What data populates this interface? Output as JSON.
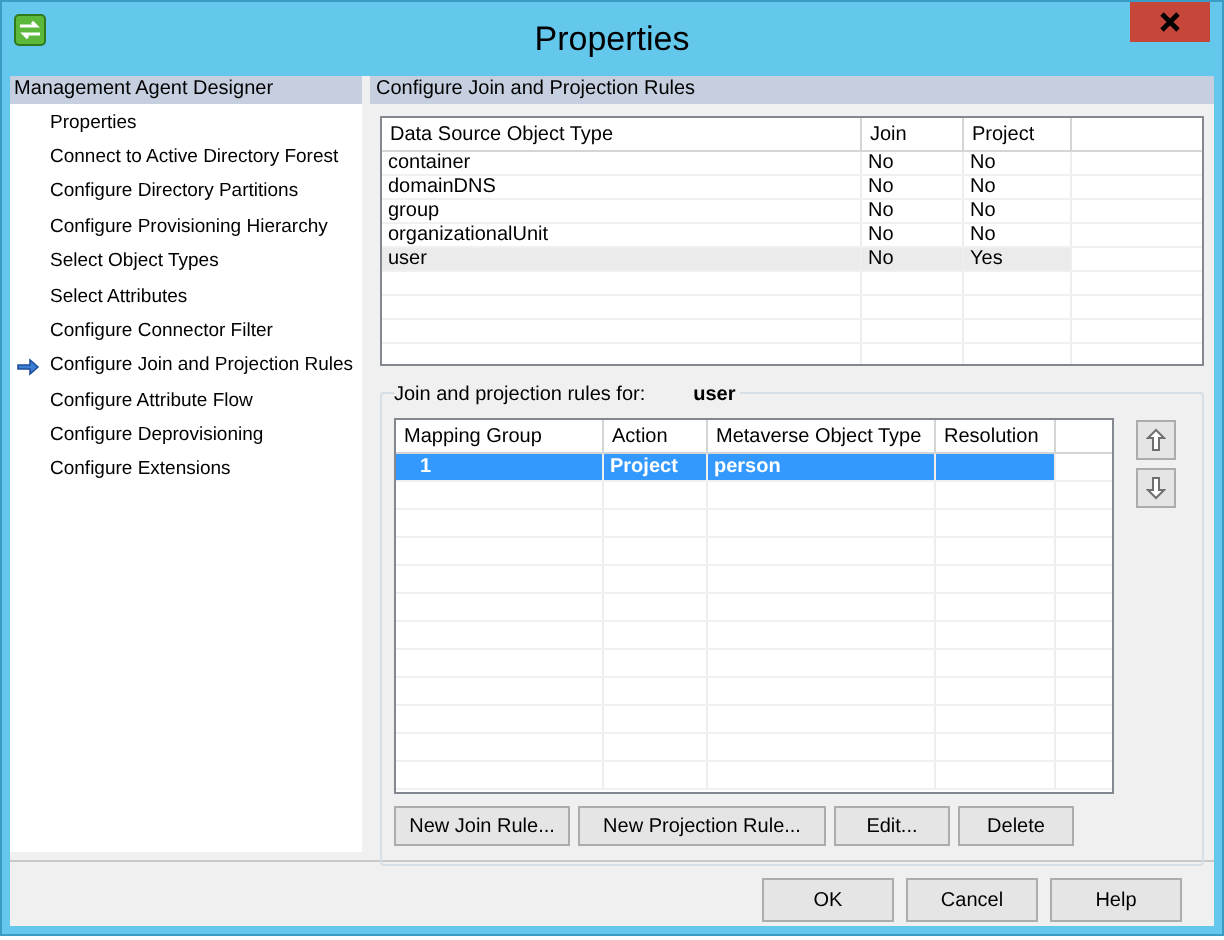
{
  "window": {
    "title": "Properties"
  },
  "sidebar": {
    "header": "Management Agent Designer",
    "items": [
      {
        "label": "Properties",
        "selected": false
      },
      {
        "label": "Connect to Active Directory Forest",
        "selected": false
      },
      {
        "label": "Configure Directory Partitions",
        "selected": false
      },
      {
        "label": "Configure Provisioning Hierarchy",
        "selected": false
      },
      {
        "label": "Select Object Types",
        "selected": false
      },
      {
        "label": "Select Attributes",
        "selected": false
      },
      {
        "label": "Configure Connector Filter",
        "selected": false
      },
      {
        "label": "Configure Join and Projection Rules",
        "selected": true
      },
      {
        "label": "Configure Attribute Flow",
        "selected": false
      },
      {
        "label": "Configure Deprovisioning",
        "selected": false
      },
      {
        "label": "Configure Extensions",
        "selected": false
      }
    ]
  },
  "panel": {
    "header": "Configure Join and Projection Rules",
    "object_types": {
      "columns": [
        "Data Source Object Type",
        "Join",
        "Project"
      ],
      "rows": [
        {
          "cells": [
            "container",
            "No",
            "No"
          ],
          "selected": false
        },
        {
          "cells": [
            "domainDNS",
            "No",
            "No"
          ],
          "selected": false
        },
        {
          "cells": [
            "group",
            "No",
            "No"
          ],
          "selected": false
        },
        {
          "cells": [
            "organizationalUnit",
            "No",
            "No"
          ],
          "selected": false
        },
        {
          "cells": [
            "user",
            "No",
            "Yes"
          ],
          "selected": true
        }
      ]
    },
    "rules": {
      "label": "Join and projection rules for:",
      "object_type": "user",
      "columns": [
        "Mapping Group",
        "Action",
        "Metaverse Object Type",
        "Resolution"
      ],
      "rows": [
        {
          "cells": [
            "1",
            "Project",
            "person"
          ],
          "selected": true
        }
      ],
      "buttons": [
        "New Join Rule...",
        "New Projection Rule...",
        "Edit...",
        "Delete"
      ]
    }
  },
  "buttons": [
    "OK",
    "Cancel",
    "Help"
  ]
}
